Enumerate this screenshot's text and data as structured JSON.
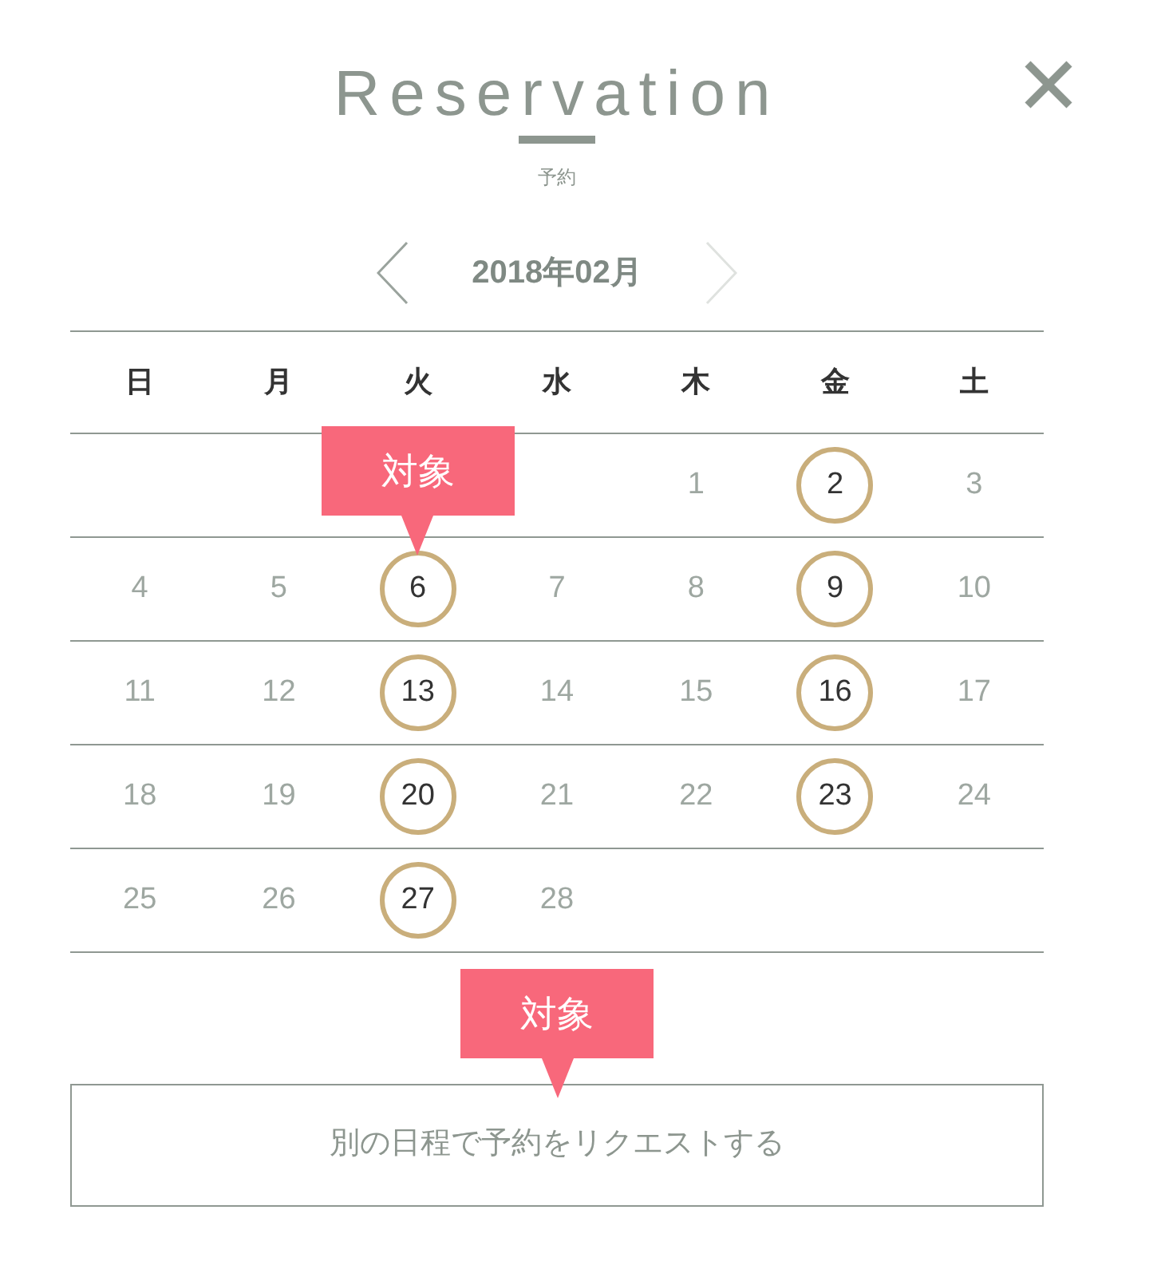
{
  "header": {
    "title": "Reservation",
    "subtitle": "予約"
  },
  "month_nav": {
    "label": "2018年02月",
    "prev": {
      "disabled": false
    },
    "next": {
      "disabled": true
    }
  },
  "calendar": {
    "weekdays": [
      "日",
      "月",
      "火",
      "水",
      "木",
      "金",
      "土"
    ],
    "weeks": [
      [
        {
          "kind": "blank"
        },
        {
          "kind": "blank"
        },
        {
          "kind": "blank"
        },
        {
          "kind": "blank"
        },
        {
          "kind": "day",
          "day": "1",
          "available": false
        },
        {
          "kind": "day",
          "day": "2",
          "available": true
        },
        {
          "kind": "day",
          "day": "3",
          "available": false
        }
      ],
      [
        {
          "kind": "day",
          "day": "4",
          "available": false
        },
        {
          "kind": "day",
          "day": "5",
          "available": false
        },
        {
          "kind": "day",
          "day": "6",
          "available": true,
          "tooltip": "対象"
        },
        {
          "kind": "day",
          "day": "7",
          "available": false
        },
        {
          "kind": "day",
          "day": "8",
          "available": false
        },
        {
          "kind": "day",
          "day": "9",
          "available": true
        },
        {
          "kind": "day",
          "day": "10",
          "available": false
        }
      ],
      [
        {
          "kind": "day",
          "day": "11",
          "available": false
        },
        {
          "kind": "day",
          "day": "12",
          "available": false
        },
        {
          "kind": "day",
          "day": "13",
          "available": true
        },
        {
          "kind": "day",
          "day": "14",
          "available": false
        },
        {
          "kind": "day",
          "day": "15",
          "available": false
        },
        {
          "kind": "day",
          "day": "16",
          "available": true
        },
        {
          "kind": "day",
          "day": "17",
          "available": false
        }
      ],
      [
        {
          "kind": "day",
          "day": "18",
          "available": false
        },
        {
          "kind": "day",
          "day": "19",
          "available": false
        },
        {
          "kind": "day",
          "day": "20",
          "available": true
        },
        {
          "kind": "day",
          "day": "21",
          "available": false
        },
        {
          "kind": "day",
          "day": "22",
          "available": false
        },
        {
          "kind": "day",
          "day": "23",
          "available": true
        },
        {
          "kind": "day",
          "day": "24",
          "available": false
        }
      ],
      [
        {
          "kind": "day",
          "day": "25",
          "available": false
        },
        {
          "kind": "day",
          "day": "26",
          "available": false
        },
        {
          "kind": "day",
          "day": "27",
          "available": true
        },
        {
          "kind": "day",
          "day": "28",
          "available": false
        }
      ]
    ]
  },
  "request_button": {
    "label": "別の日程で予約をリクエストする",
    "tooltip": "対象"
  }
}
